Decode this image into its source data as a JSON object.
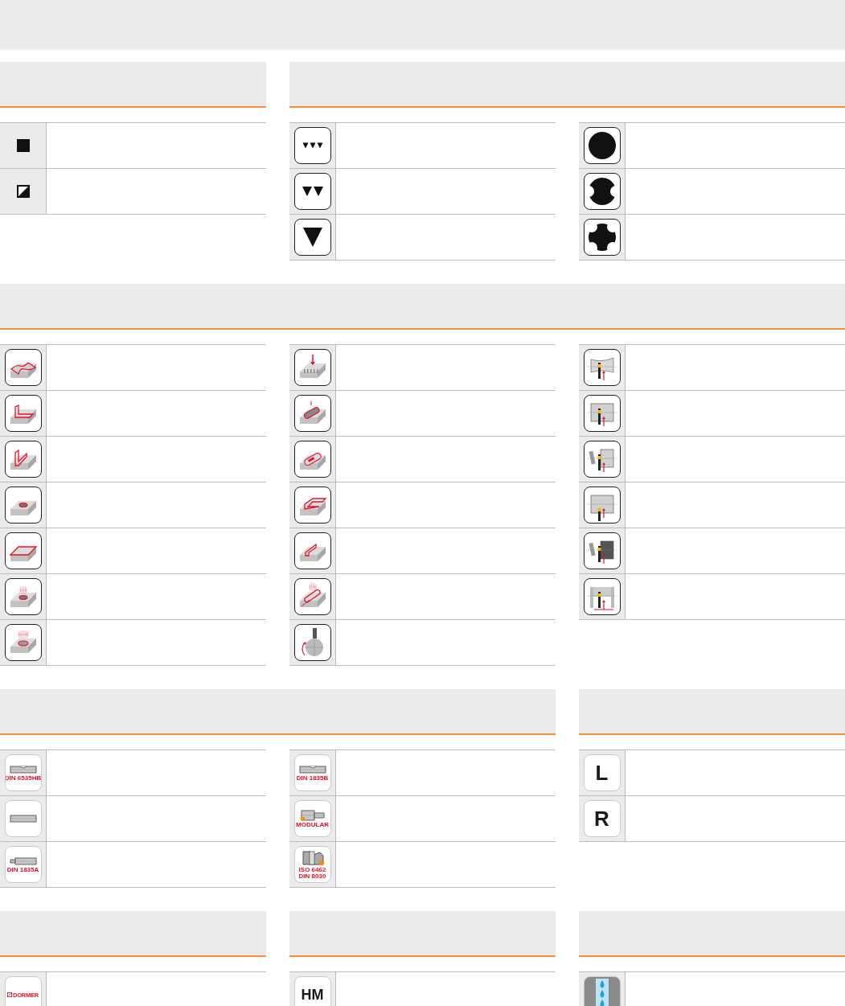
{
  "bands": [
    {
      "sections": [
        {
          "columns": [
            [
              {
                "kind": "square"
              },
              {
                "kind": "half_square"
              }
            ]
          ]
        },
        {
          "columns": [
            [
              {
                "kind": "tri_small"
              },
              {
                "kind": "tri_medium"
              },
              {
                "kind": "tri_large"
              }
            ],
            [
              {
                "kind": "circle"
              },
              {
                "kind": "circle_two_notch"
              },
              {
                "kind": "circle_four_notch"
              }
            ]
          ]
        }
      ]
    },
    {
      "sections": [
        {
          "columns": [
            [
              {
                "kind": "surface"
              },
              {
                "kind": "shoulder"
              },
              {
                "kind": "slot_open"
              },
              {
                "kind": "hole"
              },
              {
                "kind": "face"
              },
              {
                "kind": "helical_hole"
              },
              {
                "kind": "helical_bore"
              }
            ],
            [
              {
                "kind": "plunge"
              },
              {
                "kind": "ramp_pocket"
              },
              {
                "kind": "pocket"
              },
              {
                "kind": "shoulder_long"
              },
              {
                "kind": "slot"
              },
              {
                "kind": "slot_ramp"
              },
              {
                "kind": "circular"
              }
            ],
            [
              {
                "kind": "profile_turn"
              },
              {
                "kind": "groove"
              },
              {
                "kind": "face_groove"
              },
              {
                "kind": "groove_internal"
              },
              {
                "kind": "face_groove_deep"
              },
              {
                "kind": "parting"
              }
            ]
          ]
        }
      ]
    },
    {
      "sections": [
        {
          "columns": [
            [
              {
                "kind": "shank_flat",
                "label": "DIN 6535HB"
              },
              {
                "kind": "shank_plain"
              },
              {
                "kind": "shank_step",
                "label": "DIN 1835A"
              }
            ],
            [
              {
                "kind": "shank_flat",
                "label": "DIN 1835B"
              },
              {
                "kind": "shank_modular",
                "label": "MODULAR"
              },
              {
                "kind": "shank_arbor",
                "label": "ISO 6462 DIN 8030"
              }
            ]
          ]
        },
        {
          "columns": [
            [
              {
                "kind": "letter",
                "label": "L"
              },
              {
                "kind": "letter",
                "label": "R"
              }
            ]
          ]
        }
      ]
    },
    {
      "sections": [
        {
          "columns": [
            [
              {
                "kind": "brand",
                "label": "DORMER"
              }
            ]
          ]
        },
        {
          "columns": [
            [
              {
                "kind": "letter",
                "label": "HM"
              }
            ]
          ]
        },
        {
          "columns": [
            [
              {
                "kind": "coolant"
              }
            ]
          ]
        }
      ]
    }
  ]
}
